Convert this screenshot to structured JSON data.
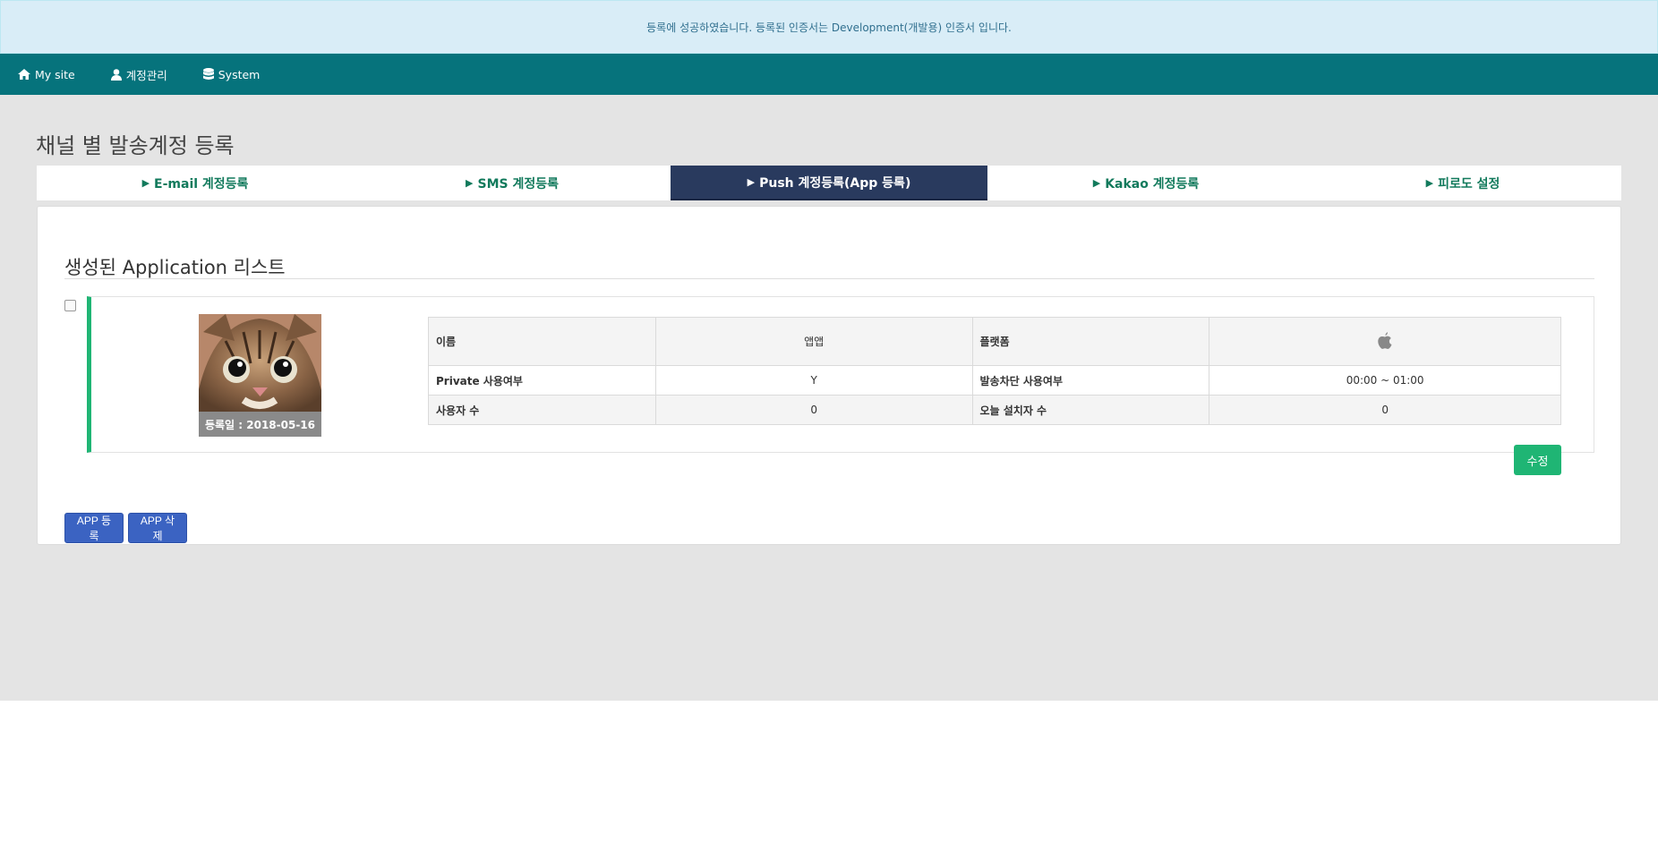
{
  "alert": {
    "message": "등록에 성공하였습니다. 등록된 인증서는 Development(개발용) 인증서 입니다."
  },
  "navbar": {
    "items": [
      {
        "label": "My site",
        "icon": "home-icon"
      },
      {
        "label": "계정관리",
        "icon": "user-icon"
      },
      {
        "label": "System",
        "icon": "database-icon"
      }
    ]
  },
  "page": {
    "title": "채널 별 발송계정 등록"
  },
  "tabs": [
    {
      "label": "E-mail 계정등록"
    },
    {
      "label": "SMS 계정등록"
    },
    {
      "label": "Push 계정등록(App 등록)",
      "active": true
    },
    {
      "label": "Kakao 계정등록"
    },
    {
      "label": "피로도 설정"
    }
  ],
  "tab_marker": "▶",
  "section": {
    "title": "생성된 Application 리스트"
  },
  "app": {
    "date_label": "등록일 : 2018-05-16",
    "rows": [
      {
        "k1": "이름",
        "v1": "앱앱",
        "k2": "플랫폼",
        "v2": ""
      },
      {
        "k1": "Private 사용여부",
        "v1": "Y",
        "k2": "발송차단 사용여부",
        "v2": "00:00 ~ 01:00"
      },
      {
        "k1": "사용자 수",
        "v1": "0",
        "k2": "오늘 설치자 수",
        "v2": "0"
      }
    ],
    "platform_icon": "apple-icon",
    "edit_label": "수정"
  },
  "actions": {
    "add_label": "APP 등록",
    "delete_label": "APP 삭제"
  },
  "colors": {
    "navbar": "#06737c",
    "active_tab": "#293a5e",
    "tab_text": "#127a5c",
    "accent_green": "#1fb574",
    "button_blue": "#3b63c2"
  }
}
